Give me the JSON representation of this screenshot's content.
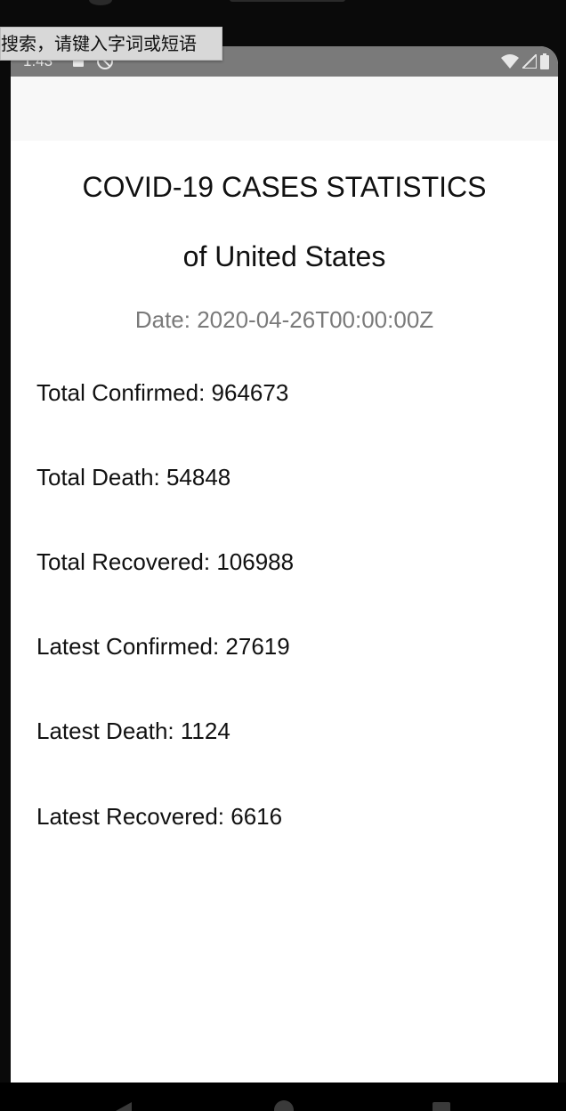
{
  "status_bar": {
    "time": "1:43"
  },
  "ime_popup": {
    "text": "搜索，请键入字词或短语"
  },
  "header": {
    "title": "COVID-19 CASES STATISTICS",
    "subtitle": "of United States",
    "date": "Date: 2020-04-26T00:00:00Z"
  },
  "stats": [
    {
      "label": "Total Confirmed: 964673"
    },
    {
      "label": "Total Death: 54848"
    },
    {
      "label": "Total Recovered: 106988"
    },
    {
      "label": "Latest Confirmed: 27619"
    },
    {
      "label": "Latest Death: 1124"
    },
    {
      "label": "Latest Recovered: 6616"
    }
  ],
  "icons": {
    "status_left": [
      "notification-square-icon",
      "do-not-disturb-icon"
    ],
    "status_right": [
      "wifi-icon",
      "cell-signal-icon",
      "battery-icon"
    ],
    "nav": [
      "back-icon",
      "home-icon",
      "recent-apps-icon"
    ]
  },
  "colors": {
    "status_bar": "#7a7a7a",
    "app_bar": "#f8f8f8",
    "text_primary": "#111111",
    "text_secondary": "#7a7a7a"
  }
}
